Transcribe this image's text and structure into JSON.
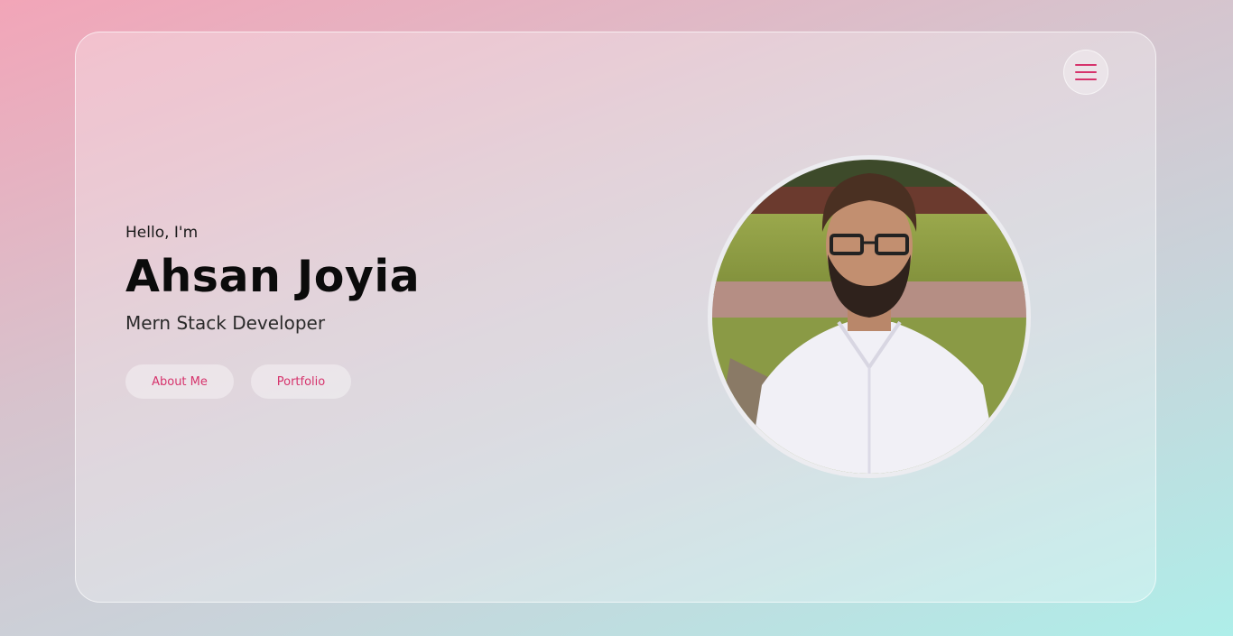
{
  "hero": {
    "greeting": "Hello, I'm",
    "name": "Ahsan Joyia",
    "role": "Mern Stack Developer",
    "buttons": {
      "about": "About Me",
      "portfolio": "Portfolio"
    }
  },
  "nav": {
    "menu_icon": "hamburger-menu-icon"
  },
  "colors": {
    "accent": "#d6336c",
    "text": "#0b0b0b"
  }
}
